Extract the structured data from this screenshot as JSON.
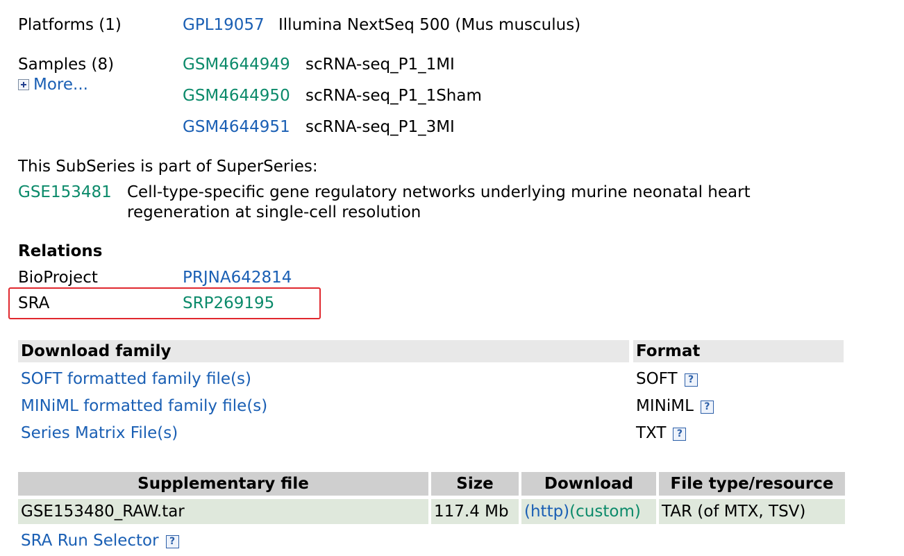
{
  "platforms": {
    "label": "Platforms (1)",
    "id": "GPL19057",
    "desc": "Illumina NextSeq 500 (Mus musculus)"
  },
  "samples": {
    "label": "Samples (8)",
    "more": "More...",
    "items": [
      {
        "id": "GSM4644949",
        "title": "scRNA-seq_P1_1MI"
      },
      {
        "id": "GSM4644950",
        "title": "scRNA-seq_P1_1Sham"
      },
      {
        "id": "GSM4644951",
        "title": "scRNA-seq_P1_3MI"
      }
    ]
  },
  "superseries": {
    "intro": "This SubSeries is part of SuperSeries:",
    "id": "GSE153481",
    "title_line1": "Cell-type-specific gene regulatory networks underlying murine neonatal heart",
    "title_line2": "regeneration at single-cell resolution"
  },
  "relations": {
    "heading": "Relations",
    "rows": [
      {
        "label": "BioProject",
        "value": "PRJNA642814"
      },
      {
        "label": "SRA",
        "value": "SRP269195"
      }
    ]
  },
  "download_family": {
    "header_family": "Download family",
    "header_format": "Format",
    "rows": [
      {
        "label": "SOFT formatted family file(s)",
        "format": "SOFT"
      },
      {
        "label": "MINiML formatted family file(s)",
        "format": "MINiML"
      },
      {
        "label": "Series Matrix File(s)",
        "format": "TXT"
      }
    ],
    "help_glyph": "?"
  },
  "supplementary": {
    "headers": [
      "Supplementary file",
      "Size",
      "Download",
      "File type/resource"
    ],
    "row": {
      "file": "GSE153480_RAW.tar",
      "size": "117.4 Mb",
      "http": "(http)",
      "custom": "(custom)",
      "type": "TAR (of MTX, TSV)"
    },
    "run_selector": "SRA Run Selector"
  },
  "colors": {
    "link_blue": "#1a5fb4",
    "link_green": "#0b8a6a",
    "highlight_red": "#e0282e"
  }
}
